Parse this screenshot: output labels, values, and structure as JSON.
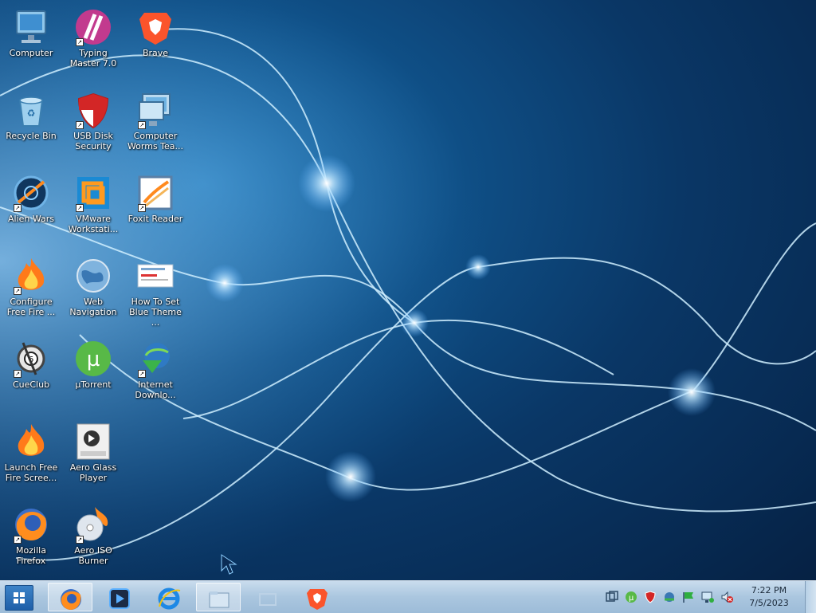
{
  "desktop": {
    "icons": [
      {
        "label": "Computer"
      },
      {
        "label": "Typing Master 7.0"
      },
      {
        "label": "Brave"
      },
      {
        "label": "Recycle Bin"
      },
      {
        "label": "USB Disk Security"
      },
      {
        "label": "Computer Worms Tea..."
      },
      {
        "label": "Alien Wars"
      },
      {
        "label": "VMware Workstati..."
      },
      {
        "label": "Foxit Reader"
      },
      {
        "label": "Configure Free Fire ..."
      },
      {
        "label": "Web Navigation"
      },
      {
        "label": "How To Set Blue Theme ..."
      },
      {
        "label": "CueClub"
      },
      {
        "label": "µTorrent"
      },
      {
        "label": "Internet Downlo..."
      },
      {
        "label": "Launch Free Fire Scree..."
      },
      {
        "label": "Aero Glass Player"
      },
      {
        "label": "Mozilla Firefox"
      },
      {
        "label": "Aero ISO Burner"
      }
    ]
  },
  "taskbar": {
    "pinned": [
      "firefox-icon",
      "media-player-icon",
      "internet-explorer-icon",
      "file-explorer-icon",
      "blank-window-icon",
      "brave-icon"
    ],
    "tray_icons": [
      "action-center-icon",
      "utorrent-icon",
      "usb-security-icon",
      "network-globe-icon",
      "flag-icon",
      "network-icon",
      "volume-muted-icon"
    ],
    "clock": {
      "time": "7:22 PM",
      "date": "7/5/2023"
    }
  },
  "colors": {
    "wallpaper": "#0a3766",
    "taskbar": "#aac6df"
  }
}
